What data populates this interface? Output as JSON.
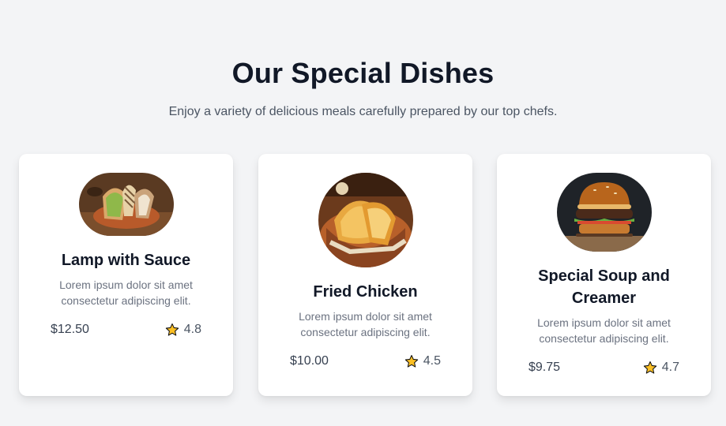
{
  "section": {
    "title": "Our Special Dishes",
    "subtitle": "Enjoy a variety of delicious meals carefully prepared by our top chefs."
  },
  "dishes": [
    {
      "name": "Lamp with Sauce",
      "description": "Lorem ipsum dolor sit amet consectetur adipiscing elit.",
      "price": "$12.50",
      "rating": "4.8",
      "image_icon": "sandwich-wrap-photo"
    },
    {
      "name": "Fried Chicken",
      "description": "Lorem ipsum dolor sit amet consectetur adipiscing elit.",
      "price": "$10.00",
      "rating": "4.5",
      "image_icon": "fried-chicken-basket-photo"
    },
    {
      "name": "Special Soup and Creamer",
      "description": "Lorem ipsum dolor sit amet consectetur adipiscing elit.",
      "price": "$9.75",
      "rating": "4.7",
      "image_icon": "burger-photo"
    }
  ],
  "colors": {
    "background": "#f3f4f6",
    "card": "#ffffff",
    "heading": "#111827",
    "text_muted": "#6b7280",
    "star": "#fbbf24"
  }
}
